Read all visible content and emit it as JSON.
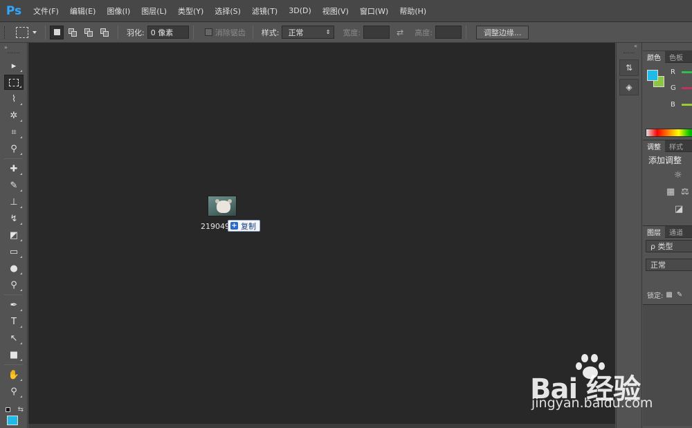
{
  "app": {
    "logo": "Ps"
  },
  "menu": [
    {
      "id": "file",
      "label": "文件(F)"
    },
    {
      "id": "edit",
      "label": "编辑(E)"
    },
    {
      "id": "image",
      "label": "图像(I)"
    },
    {
      "id": "layer",
      "label": "图层(L)"
    },
    {
      "id": "type",
      "label": "类型(Y)"
    },
    {
      "id": "select",
      "label": "选择(S)"
    },
    {
      "id": "filter",
      "label": "滤镜(T)"
    },
    {
      "id": "3d",
      "label": "3D(D)"
    },
    {
      "id": "view",
      "label": "视图(V)"
    },
    {
      "id": "window",
      "label": "窗口(W)"
    },
    {
      "id": "help",
      "label": "帮助(H)"
    }
  ],
  "options": {
    "feather_label": "羽化:",
    "feather_value": "0 像素",
    "antialias_label": "消除锯齿",
    "style_label": "样式:",
    "style_value": "正常",
    "width_label": "宽度:",
    "height_label": "高度:",
    "refine_edge_label": "调整边缘..."
  },
  "toolbar": {
    "collapse": "»",
    "tools": [
      {
        "name": "move-tool",
        "icon": "▸"
      },
      {
        "name": "rect-marquee-tool",
        "icon": "⬚"
      },
      {
        "name": "lasso-tool",
        "icon": "⌇"
      },
      {
        "name": "magic-wand-tool",
        "icon": "✲"
      },
      {
        "name": "crop-tool",
        "icon": "⌗"
      },
      {
        "name": "eyedropper-tool",
        "icon": "⚲"
      },
      {
        "name": "healing-brush-tool",
        "icon": "✚"
      },
      {
        "name": "brush-tool",
        "icon": "✎"
      },
      {
        "name": "clone-stamp-tool",
        "icon": "⊥"
      },
      {
        "name": "history-brush-tool",
        "icon": "↯"
      },
      {
        "name": "eraser-tool",
        "icon": "◩"
      },
      {
        "name": "gradient-tool",
        "icon": "▭"
      },
      {
        "name": "blur-tool",
        "icon": "●"
      },
      {
        "name": "dodge-tool",
        "icon": "⚲"
      },
      {
        "name": "pen-tool",
        "icon": "✒"
      },
      {
        "name": "type-tool",
        "icon": "T"
      },
      {
        "name": "path-selection-tool",
        "icon": "↖"
      },
      {
        "name": "shape-tool",
        "icon": "■"
      },
      {
        "name": "hand-tool",
        "icon": "✋"
      },
      {
        "name": "zoom-tool",
        "icon": "⚲"
      }
    ],
    "foreground_color": "#21b9e6"
  },
  "canvas": {
    "drag_file_name": "219049",
    "copy_tip": "复制",
    "copy_icon": "+"
  },
  "dock": {
    "collapse": "«"
  },
  "panels": {
    "color_tabs": [
      "颜色",
      "色板"
    ],
    "channels": [
      {
        "label": "R",
        "color": "#2fbf4f"
      },
      {
        "label": "G",
        "color": "#c0335a"
      },
      {
        "label": "B",
        "color": "#9acd32"
      }
    ],
    "fg_color": "#21b9e6",
    "bg_color": "#8dc63f",
    "adjust_tabs": [
      "调整",
      "样式"
    ],
    "adjust_title": "添加调整",
    "layers_tabs": [
      "图层",
      "通道"
    ],
    "layers_kind": "ρ 类型",
    "blend_mode": "正常",
    "lock_label": "锁定:"
  },
  "watermark": {
    "brand": "Bai  经验",
    "url": "jingyan.baidu.com"
  }
}
